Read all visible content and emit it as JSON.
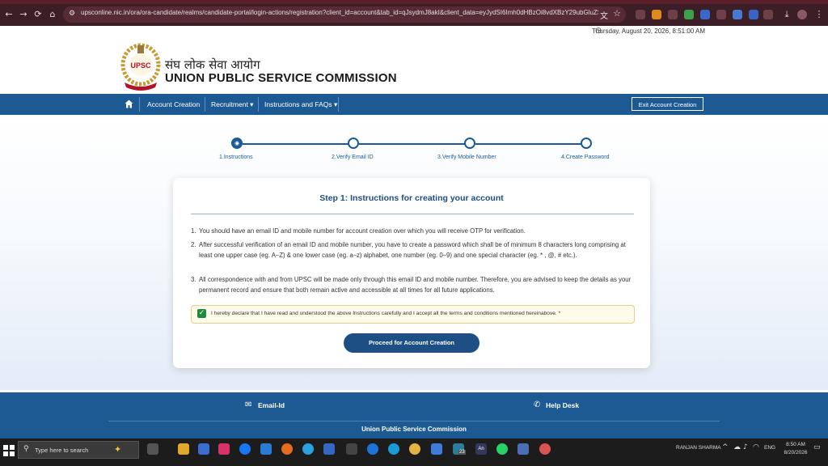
{
  "browser": {
    "url": "upsconline.nic.in/ora/ora-candidate/realms/candidate-portal/login-actions/registration?client_id=account&tab_id=qJsydmJ8akI&client_data=eyJydSI6Imh0dHBzOi8vdXBzY29ubGluZS5uaWM..."
  },
  "date_time": "Thursday, August 20, 2026, 8:51:00 AM",
  "header": {
    "emblem_text": "UPSC",
    "hindi_name": "संघ लोक सेवा आयोग",
    "english_name": "UNION PUBLIC SERVICE COMMISSION"
  },
  "navbar": {
    "home_icon": "home-icon",
    "items": [
      {
        "label": "Account Creation"
      },
      {
        "label": "Recruitment ▾"
      },
      {
        "label": "Instructions and FAQs ▾"
      }
    ],
    "exit_label": "Exit Account Creation"
  },
  "stepper": {
    "steps": [
      {
        "label": "1.Instructions",
        "active": true
      },
      {
        "label": "2.Verify Email ID",
        "active": false
      },
      {
        "label": "3.Verify Mobile Number",
        "active": false
      },
      {
        "label": "4.Create Password",
        "active": false
      }
    ]
  },
  "card": {
    "title": "Step 1: Instructions for creating your account",
    "instructions": [
      {
        "num": "1.",
        "text": "You should have an email ID and mobile number for account creation over which you will receive OTP for verification."
      },
      {
        "num": "2.",
        "text": "After successful verification of an email ID and mobile number, you have to create a password which shall be of minimum 8 characters long comprising at least one upper case (eg. A–Z) & one lower case (eg. a–z) alphabet, one number (eg. 0–9) and one special character (eg. * , @, # etc.)."
      },
      {
        "num": "3.",
        "text": "All correspondence with and from UPSC will be made only through this email ID and mobile number. Therefore, you are advised to keep the details as your permanent record and ensure that both remain active and accessible at all times for all future applications."
      }
    ],
    "declaration": "I hereby declare that I have read and understood the above Instructions carefully and I accept all the terms and conditions mentioned hereinabove. *",
    "declaration_checked": true,
    "proceed_label": "Proceed for Account Creation"
  },
  "footer": {
    "email_label": "Email-Id",
    "helpdesk_label": "Help Desk",
    "org": "Union Public Service Commission"
  },
  "taskbar": {
    "search_placeholder": "Type here to search",
    "badge_count": "23",
    "user": "RANJAN SHARMA",
    "lang": "ENG",
    "time": "8:50 AM",
    "date": "8/20/2026"
  },
  "colors": {
    "primary_blue": "#1d5a93",
    "title_blue": "#1d4e84",
    "check_green": "#1f8a3b",
    "browser_bar": "#3b1e26"
  }
}
